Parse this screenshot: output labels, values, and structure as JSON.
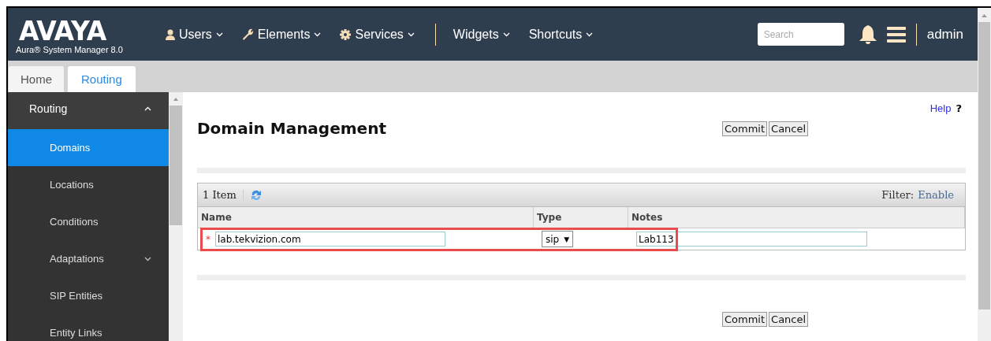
{
  "header": {
    "logo": "AVAYA",
    "product": "Aura® System Manager 8.0",
    "menus": [
      {
        "label": "Users"
      },
      {
        "label": "Elements"
      },
      {
        "label": "Services"
      },
      {
        "label": "Widgets"
      },
      {
        "label": "Shortcuts"
      }
    ],
    "search": {
      "placeholder": "Search"
    },
    "user": "admin"
  },
  "tabs": [
    {
      "label": "Home",
      "selected": false
    },
    {
      "label": "Routing",
      "selected": true
    }
  ],
  "sidebar": {
    "group": {
      "label": "Routing",
      "expanded": true
    },
    "items": [
      {
        "label": "Domains",
        "selected": true,
        "kind": "page"
      },
      {
        "label": "Locations",
        "selected": false,
        "kind": "page"
      },
      {
        "label": "Conditions",
        "selected": false,
        "kind": "page"
      },
      {
        "label": "Adaptations",
        "selected": false,
        "kind": "folder"
      },
      {
        "label": "SIP Entities",
        "selected": false,
        "kind": "page"
      },
      {
        "label": "Entity Links",
        "selected": false,
        "kind": "page"
      }
    ]
  },
  "content": {
    "title": "Domain Management",
    "help": "Help",
    "help_mark": "?",
    "buttons": [
      "Commit",
      "Cancel"
    ],
    "table": {
      "count": "1 Item",
      "filter_label": "Filter:",
      "filter_link": "Enable",
      "columns": [
        "Name",
        "Type",
        "Notes"
      ],
      "rows": [
        {
          "required_mark": "*",
          "name": "lab.tekvizion.com",
          "type": "sip",
          "type_arrow": "▼",
          "notes": "Lab113",
          "highlighted": true
        }
      ]
    },
    "bottom_buttons": [
      "Commit",
      "Cancel"
    ]
  }
}
